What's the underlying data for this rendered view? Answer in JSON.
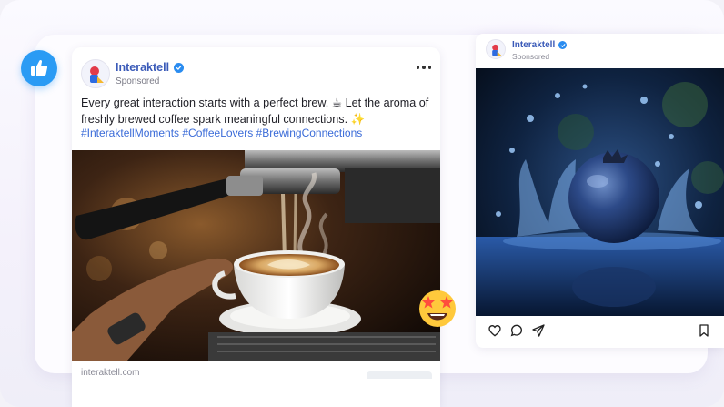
{
  "fb_post": {
    "brand": "Interaktell",
    "sponsored": "Sponsored",
    "caption": "Every great interaction starts with a perfect brew. ☕ Let the aroma of freshly brewed coffee spark meaningful connections. ✨",
    "hashtags": "#InteraktellMoments #CoffeeLovers #BrewingConnections",
    "url": "interaktell.com",
    "icons": [
      "verified-badge",
      "more-options"
    ]
  },
  "ig_post": {
    "brand": "Interaktell",
    "sponsored": "Sponsored",
    "icons": [
      "heart",
      "comment",
      "share",
      "bookmark"
    ]
  },
  "decor": {
    "badge_icon": "thumbs-up",
    "emoji": "star-struck",
    "colors": {
      "brand_blue": "#3a5ab8",
      "hashtag_blue": "#3a6bd8",
      "badge_blue": "#2a9bf4"
    }
  }
}
